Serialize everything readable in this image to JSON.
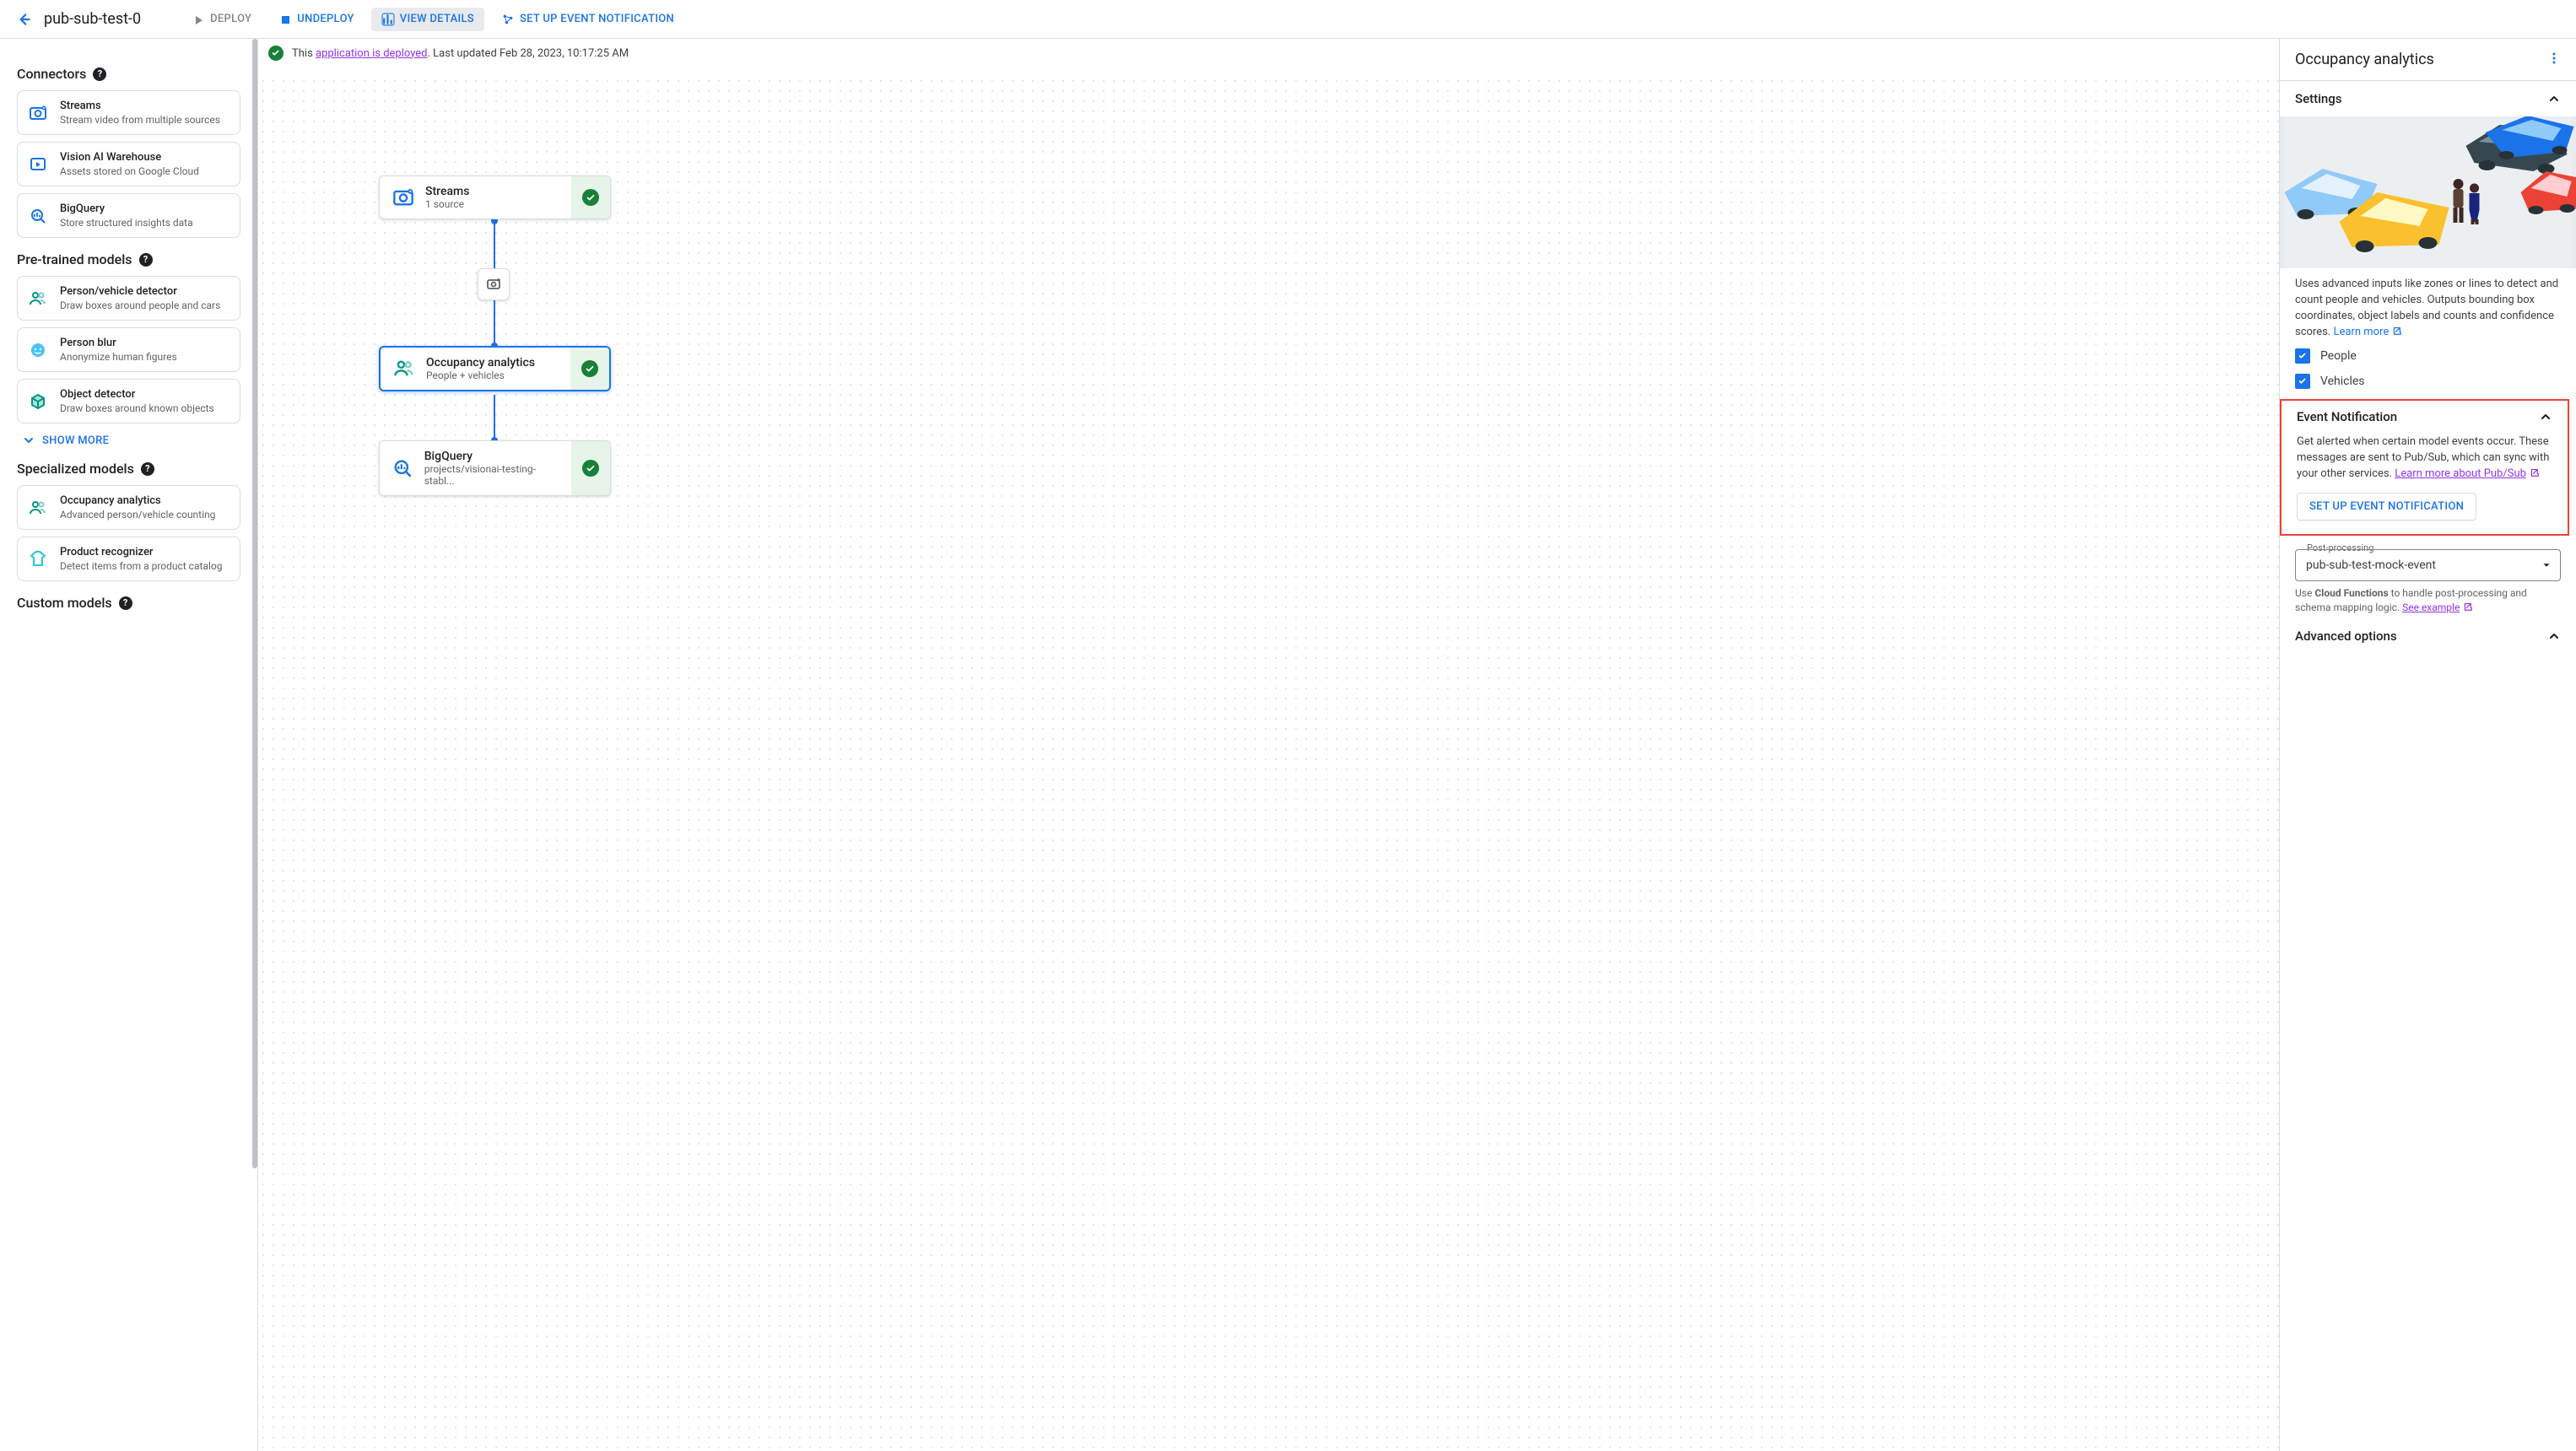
{
  "header": {
    "app_name": "pub-sub-test-0",
    "actions": {
      "deploy": "Deploy",
      "undeploy": "Undeploy",
      "view_details": "View details",
      "setup_event": "Set up event notification"
    }
  },
  "status": {
    "prefix": "This ",
    "link_text": "application is deployed",
    "suffix": ". Last updated Feb 28, 2023, 10:17:25 AM"
  },
  "sidebar": {
    "sections": {
      "connectors": {
        "title": "Connectors",
        "items": [
          {
            "title": "Streams",
            "sub": "Stream video from multiple sources",
            "icon": "flip-camera"
          },
          {
            "title": "Vision AI Warehouse",
            "sub": "Assets stored on Google Cloud",
            "icon": "play-box"
          },
          {
            "title": "BigQuery",
            "sub": "Store structured insights data",
            "icon": "bigquery"
          }
        ]
      },
      "pretrained": {
        "title": "Pre-trained models",
        "items": [
          {
            "title": "Person/vehicle detector",
            "sub": "Draw boxes around people and cars",
            "icon": "people-alt"
          },
          {
            "title": "Person blur",
            "sub": "Anonymize human figures",
            "icon": "face"
          },
          {
            "title": "Object detector",
            "sub": "Draw boxes around known objects",
            "icon": "cube"
          }
        ],
        "show_more": "Show more"
      },
      "specialized": {
        "title": "Specialized models",
        "items": [
          {
            "title": "Occupancy analytics",
            "sub": "Advanced person/vehicle counting",
            "icon": "people-alt"
          },
          {
            "title": "Product recognizer",
            "sub": "Detect items from a product catalog",
            "icon": "tshirt"
          }
        ]
      },
      "custom": {
        "title": "Custom models"
      }
    }
  },
  "graph": {
    "nodes": {
      "streams": {
        "title": "Streams",
        "sub": "1 source"
      },
      "occupancy": {
        "title": "Occupancy analytics",
        "sub": "People + vehicles"
      },
      "bigquery": {
        "title": "BigQuery",
        "sub": "projects/visionai-testing-stabl..."
      }
    }
  },
  "panel": {
    "title": "Occupancy analytics",
    "settings_label": "Settings",
    "description": "Uses advanced inputs like zones or lines to detect and count people and vehicles. Outputs bounding box coordinates, object labels and counts and confidence scores. ",
    "learn_more": "Learn more",
    "checkbox_people": "People",
    "checkbox_vehicles": "Vehicles",
    "event": {
      "title": "Event Notification",
      "desc_prefix": "Get alerted when certain model events occur. These messages are sent to Pub/Sub, which can sync with your other services. ",
      "learn_link": "Learn more about Pub/Sub",
      "button": "Set up event notification"
    },
    "post": {
      "label": "Post-processing",
      "value": "pub-sub-test-mock-event",
      "hint_prefix": "Use ",
      "hint_bold": "Cloud Functions",
      "hint_suffix": " to handle post-processing and schema mapping logic. ",
      "see_example": "See example"
    },
    "advanced": "Advanced options"
  }
}
